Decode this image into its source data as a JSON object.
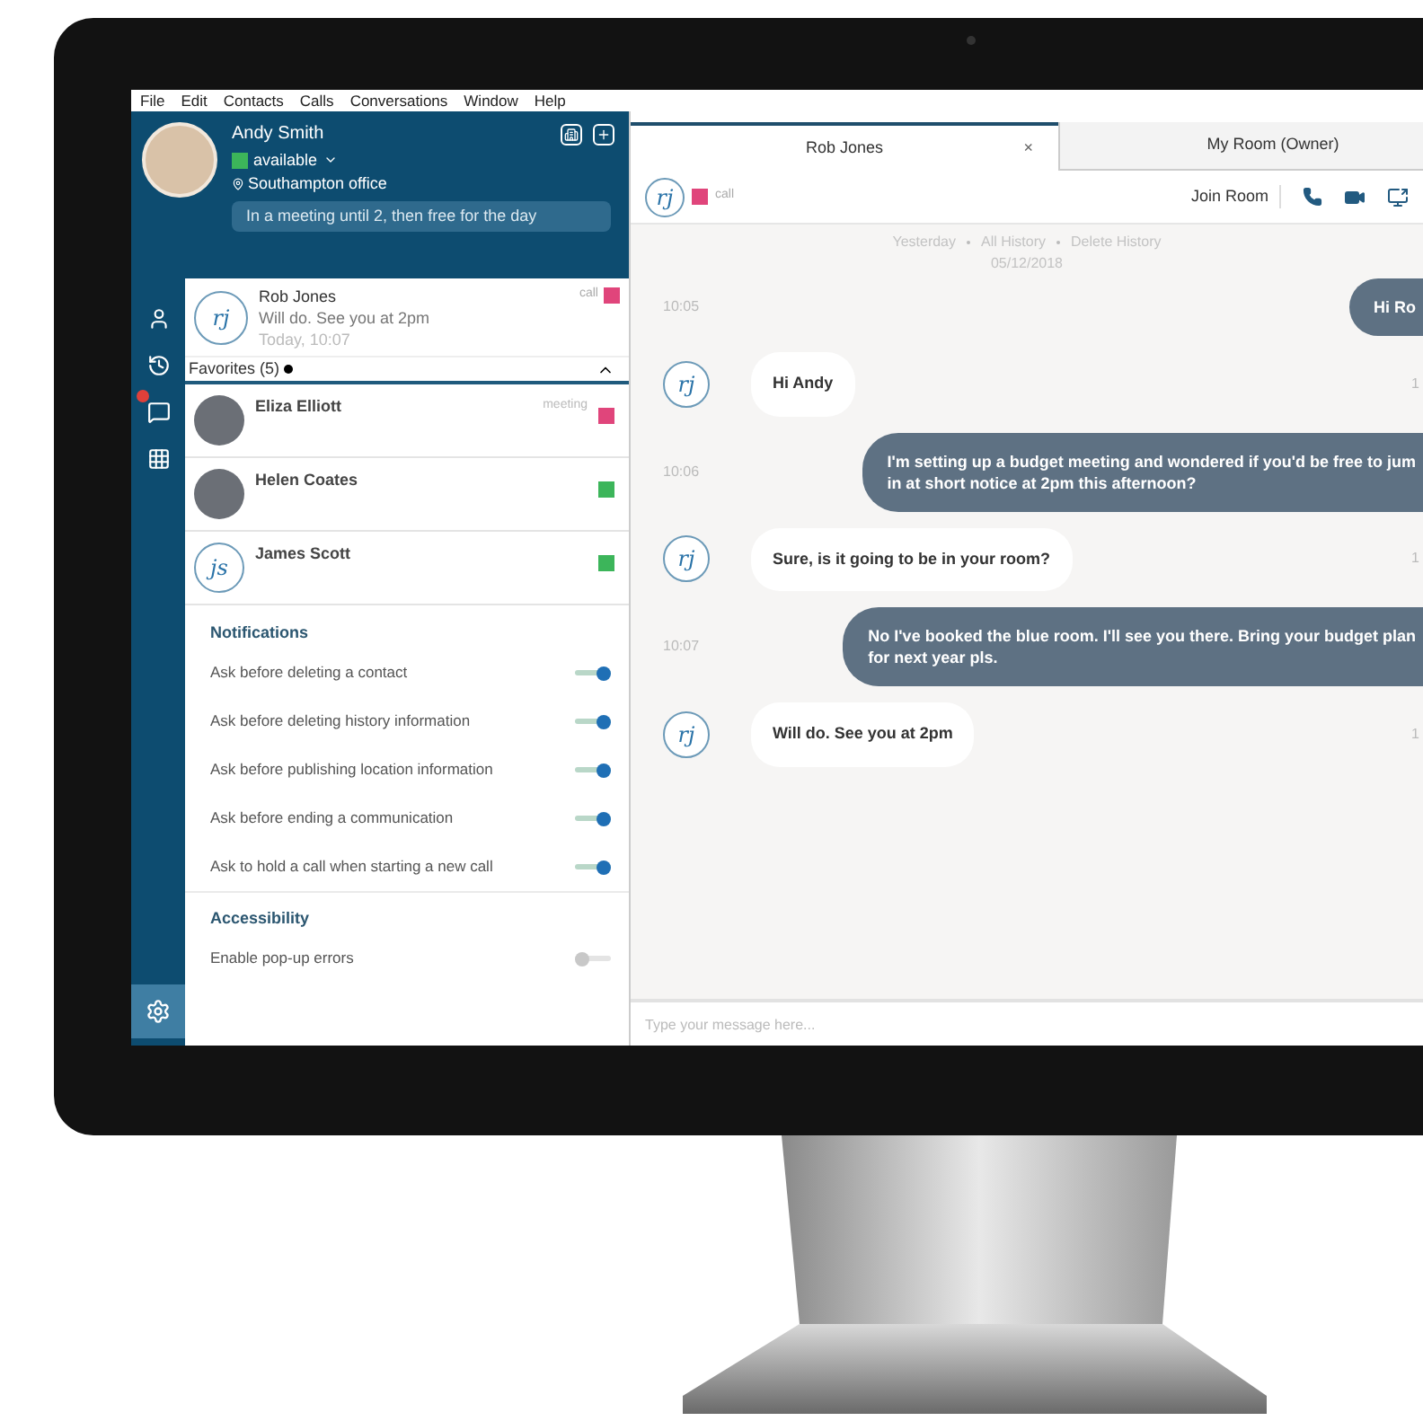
{
  "menu": [
    "File",
    "Edit",
    "Contacts",
    "Calls",
    "Conversations",
    "Window",
    "Help"
  ],
  "profile": {
    "name": "Andy Smith",
    "status": "available",
    "color": "#3cb55a",
    "location": "Southampton office",
    "note": "In a meeting until 2, then free for the day"
  },
  "rail": [
    {
      "kind": "contacts",
      "selected": false,
      "badge": false
    },
    {
      "kind": "history",
      "selected": false,
      "badge": false
    },
    {
      "kind": "chat",
      "selected": false,
      "badge": true
    },
    {
      "kind": "dialpad",
      "selected": false,
      "badge": false
    }
  ],
  "settings_button": {
    "selected": true
  },
  "recent": {
    "initials": "rj",
    "name": "Rob Jones",
    "status": "call",
    "color": "#e0457b",
    "message": "Will do. See you at 2pm",
    "time": "Today, 10:07"
  },
  "favorites": {
    "title": "Favorites (5)",
    "expanded": true,
    "contacts": [
      {
        "name": "Eliza Elliott",
        "kind": "photo",
        "status": "meeting",
        "color": "#e0457b"
      },
      {
        "name": "Helen Coates",
        "kind": "photo",
        "color": "#3cb55a"
      },
      {
        "name": "James Scott",
        "kind": "initials",
        "initials": "js",
        "color": "#3cb55a"
      }
    ]
  },
  "settings": [
    {
      "title": "Notifications",
      "items": [
        {
          "label": "Ask before deleting a contact",
          "on": true
        },
        {
          "label": "Ask before deleting history information",
          "on": true
        },
        {
          "label": "Ask before publishing location information",
          "on": true
        },
        {
          "label": "Ask before ending a communication",
          "on": true
        },
        {
          "label": "Ask to hold a call when starting a new call",
          "on": true
        }
      ]
    },
    {
      "title": "Accessibility",
      "items": [
        {
          "label": "Enable pop-up errors",
          "on": false
        }
      ]
    }
  ],
  "tabs": [
    {
      "label": "Rob Jones",
      "selected": true,
      "close": "×"
    },
    {
      "label": "My Room (Owner)",
      "selected": false
    }
  ],
  "chat_header": {
    "initials": "rj",
    "status": "call",
    "color": "#e0457b",
    "join": "Join Room"
  },
  "history_links": [
    "Yesterday",
    "All History",
    "Delete History"
  ],
  "date": "05/12/2018",
  "messages": [
    {
      "kind": "out",
      "text": "Hi Ro",
      "time": "10:05"
    },
    {
      "kind": "in",
      "initials": "rj",
      "text": "Hi Andy",
      "time": "1"
    },
    {
      "kind": "out",
      "text": "I'm setting up a budget meeting and wondered if you'd be free to jum",
      "text2": "in at short notice at 2pm this afternoon?",
      "time": "10:06"
    },
    {
      "kind": "in",
      "initials": "rj",
      "text": "Sure, is it going to be in your room?",
      "time": "1"
    },
    {
      "kind": "out",
      "text": "No I've booked the blue room. I'll see you there. Bring your budget plan",
      "text2": "for next year pls.",
      "time": "10:07"
    },
    {
      "kind": "in",
      "initials": "rj",
      "text": "Will do. See you at 2pm",
      "time": "1"
    }
  ],
  "composer": {
    "placeholder": "Type your message here..."
  }
}
